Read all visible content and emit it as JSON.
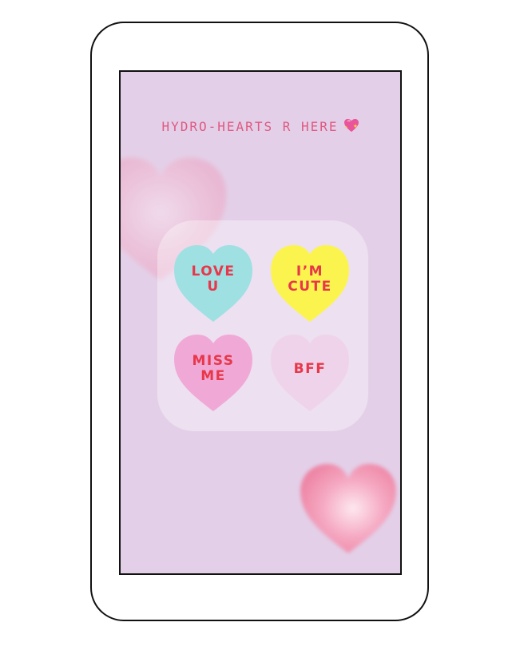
{
  "screen": {
    "headline": "HYDRO-HEARTS R HERE",
    "headline_emoji": "sparkling-heart-icon",
    "background_color": "#e3d0e8"
  },
  "hearts": [
    {
      "label": "LOVE\nU",
      "fill": "#9fe0e3",
      "text_color": "#e8374a"
    },
    {
      "label": "I’M\nCUTE",
      "fill": "#fcf44e",
      "text_color": "#e8374a"
    },
    {
      "label": "MISS\nME",
      "fill": "#f0a9d6",
      "text_color": "#e8374a"
    },
    {
      "label": "BFF",
      "fill": "#efd3ea",
      "text_color": "#e8374a"
    }
  ]
}
